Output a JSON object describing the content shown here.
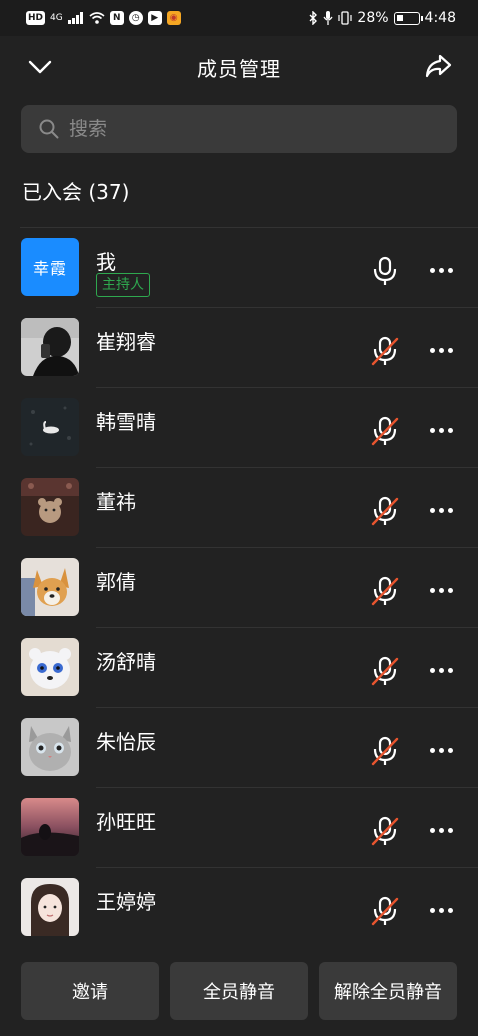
{
  "status_bar": {
    "left_chips": [
      "HD",
      "4G"
    ],
    "battery_percent": "28%",
    "time": "4:48"
  },
  "header": {
    "title": "成员管理",
    "back_icon": "chevron-down-icon",
    "share_icon": "share-icon"
  },
  "search": {
    "placeholder": "搜索",
    "value": ""
  },
  "section": {
    "title": "已入会 (37)"
  },
  "members": [
    {
      "name": "我",
      "avatar_text": "幸霞",
      "badge": "主持人",
      "mic": "on"
    },
    {
      "name": "崔翔睿",
      "avatar": "photo-person",
      "mic": "muted"
    },
    {
      "name": "韩雪晴",
      "avatar": "photo-swan",
      "mic": "muted"
    },
    {
      "name": "董祎",
      "avatar": "photo-bear",
      "mic": "muted"
    },
    {
      "name": "郭倩",
      "avatar": "photo-corgi",
      "mic": "muted"
    },
    {
      "name": "汤舒晴",
      "avatar": "photo-dog",
      "mic": "muted"
    },
    {
      "name": "朱怡辰",
      "avatar": "photo-cat",
      "mic": "muted"
    },
    {
      "name": "孙旺旺",
      "avatar": "photo-sunset",
      "mic": "muted"
    },
    {
      "name": "王婷婷",
      "avatar": "photo-girl",
      "mic": "muted"
    }
  ],
  "bottom": {
    "invite_label": "邀请",
    "mute_all_label": "全员静音",
    "unmute_all_label": "解除全员静音"
  },
  "colors": {
    "background": "#222222",
    "avatar_blue": "#1a8cff",
    "host_green": "#2fa84f",
    "muted_red": "#e8552f"
  }
}
